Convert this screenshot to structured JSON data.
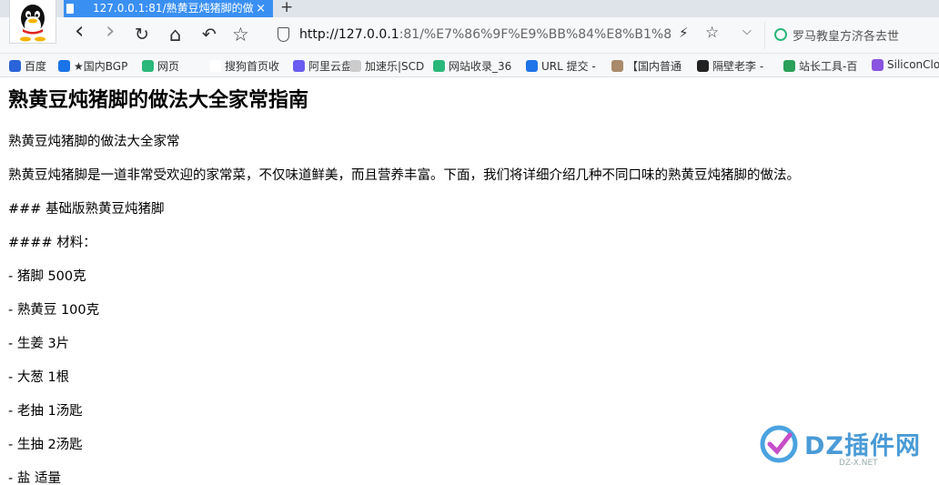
{
  "browser": {
    "tab": {
      "title": "127.0.0.1:81/熟黄豆炖猪脚的做",
      "close": "×"
    },
    "new_tab": "+",
    "nav": {
      "back": "‹",
      "forward": "›",
      "reload": "↻",
      "home": "⌂",
      "undo": "↶",
      "star": "☆"
    },
    "address": {
      "url_host": "http://127.0.0.1",
      "url_rest": ":81/%E7%86%9F%E9%BB%84%E8%B1%86%E7",
      "bolt": "⚡",
      "star": "☆"
    },
    "dropdown": "⌵",
    "search": {
      "text": "罗马教皇方济各去世"
    }
  },
  "bookmarks": [
    {
      "label": "百度",
      "color": "#2a64d8"
    },
    {
      "label": "★国内BGP",
      "color": "#1a73e8"
    },
    {
      "label": "网页",
      "color": "#2ab87a"
    },
    {
      "label": "搜狗首页收",
      "color": "#ffffff"
    },
    {
      "label": "阿里云盘",
      "color": "#6a5cf0"
    },
    {
      "label": "加速乐|SCD",
      "color": "#cccccc"
    },
    {
      "label": "网站收录_36",
      "color": "#2ab87a"
    },
    {
      "label": "URL 提交 -",
      "color": "#1e74e8"
    },
    {
      "label": "【国内普通",
      "color": "#a98a6a"
    },
    {
      "label": "隔壁老李 -",
      "color": "#222222"
    },
    {
      "label": "站长工具-百",
      "color": "#2aa05a"
    },
    {
      "label": "SiliconClo",
      "color": "#8a55e0"
    }
  ],
  "article": {
    "title": "熟黄豆炖猪脚的做法大全家常指南",
    "paragraphs": [
      "熟黄豆炖猪脚的做法大全家常",
      "熟黄豆炖猪脚是一道非常受欢迎的家常菜，不仅味道鲜美，而且营养丰富。下面，我们将详细介绍几种不同口味的熟黄豆炖猪脚的做法。",
      "### 基础版熟黄豆炖猪脚",
      "#### 材料：",
      "- 猪脚 500克",
      "- 熟黄豆 100克",
      "- 生姜 3片",
      "- 大葱 1根",
      "- 老抽 1汤匙",
      "- 生抽 2汤匙",
      "- 盐 适量"
    ]
  },
  "watermark": {
    "brand": "DZ插件网",
    "sub": "DZ-X.NET"
  }
}
